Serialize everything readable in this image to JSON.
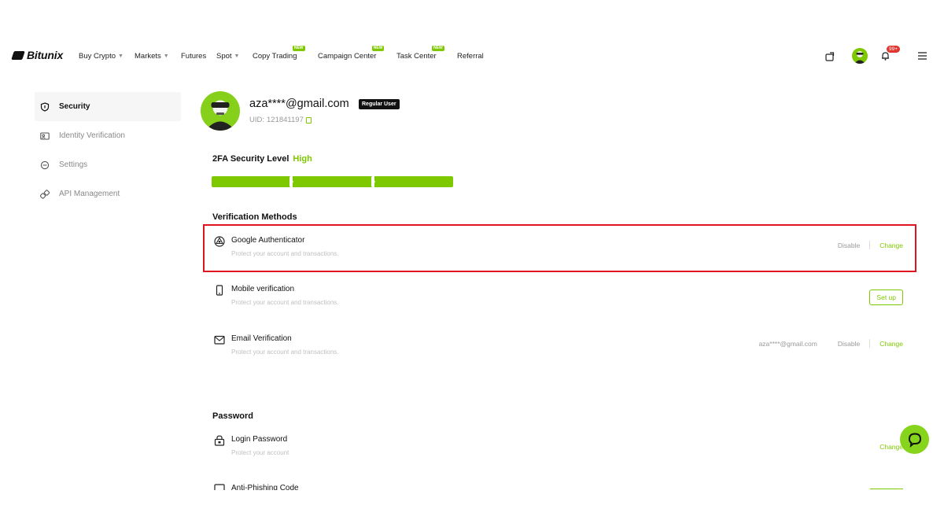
{
  "brand": {
    "name": "Bitunix"
  },
  "nav": {
    "items": [
      {
        "label": "Buy Crypto",
        "dropdown": true,
        "badge": ""
      },
      {
        "label": "Markets",
        "dropdown": true,
        "badge": ""
      },
      {
        "label": "Futures",
        "dropdown": false,
        "badge": ""
      },
      {
        "label": "Spot",
        "dropdown": true,
        "badge": ""
      },
      {
        "label": "Copy Trading",
        "dropdown": false,
        "badge": "NEW"
      },
      {
        "label": "Campaign Center",
        "dropdown": false,
        "badge": "NEW"
      },
      {
        "label": "Task Center",
        "dropdown": false,
        "badge": "NEW"
      },
      {
        "label": "Referral",
        "dropdown": false,
        "badge": ""
      }
    ],
    "right": {
      "deposit_icon": "wallet-transfer-icon",
      "notification_count": "99+",
      "menu_icon": "hamburger-icon"
    }
  },
  "sidebar": {
    "items": [
      {
        "label": "Security",
        "icon": "shield-icon",
        "active": true
      },
      {
        "label": "Identity Verification",
        "icon": "id-card-icon",
        "active": false
      },
      {
        "label": "Settings",
        "icon": "settings-icon",
        "active": false
      },
      {
        "label": "API Management",
        "icon": "api-link-icon",
        "active": false
      }
    ]
  },
  "profile": {
    "email": "aza****@gmail.com",
    "user_tag": "Regular User",
    "uid_label": "UID: ",
    "uid_value": "121841197"
  },
  "security": {
    "level_label": "2FA Security Level",
    "level_value": "High",
    "level_filled_segments": 3,
    "level_total_segments": 3
  },
  "verification": {
    "title": "Verification Methods",
    "methods": [
      {
        "name": "Google Authenticator",
        "desc": "Protect your account and transactions.",
        "icon": "google-authenticator-icon",
        "info": "",
        "disable": "Disable",
        "change": "Change",
        "setup": ""
      },
      {
        "name": "Mobile verification",
        "desc": "Protect your account and transactions.",
        "icon": "mobile-phone-icon",
        "info": "",
        "disable": "",
        "change": "",
        "setup": "Set up"
      },
      {
        "name": "Email Verification",
        "desc": "Protect your account and transactions.",
        "icon": "email-icon",
        "info": "aza****@gmail.com",
        "disable": "Disable",
        "change": "Change",
        "setup": ""
      }
    ]
  },
  "password": {
    "title": "Password",
    "items": [
      {
        "name": "Login Password",
        "desc": "Protect your account",
        "icon": "lock-icon",
        "change": "Change"
      },
      {
        "name": "Anti-Phishing Code",
        "icon": "anti-phishing-icon"
      }
    ]
  },
  "colors": {
    "accent": "#7ec800",
    "highlight": "#e0141e",
    "badge_red": "#e0362f"
  }
}
